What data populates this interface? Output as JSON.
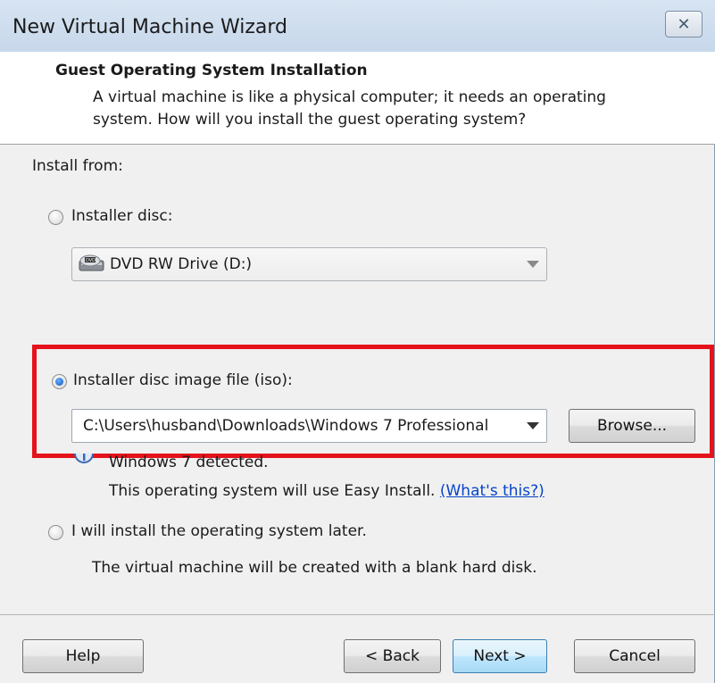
{
  "window": {
    "title": "New Virtual Machine Wizard",
    "close_glyph": "✕"
  },
  "header": {
    "title": "Guest Operating System Installation",
    "description": "A virtual machine is like a physical computer; it needs an operating system. How will you install the guest operating system?"
  },
  "install": {
    "label": "Install from:",
    "disc_option": {
      "label": "Installer disc:",
      "selected": false,
      "drive_value": "DVD RW Drive (D:)",
      "drive_icon": "dvd-drive-icon"
    },
    "iso_option": {
      "label": "Installer disc image file (iso):",
      "selected": true,
      "path_value": "C:\\Users\\husband\\Downloads\\Windows 7 Professional",
      "browse_label": "Browse..."
    },
    "detection": {
      "icon": "info-icon",
      "line1": "Windows 7 detected.",
      "line2": "This operating system will use Easy Install.",
      "link": "(What's this?)"
    },
    "later_option": {
      "label": "I will install the operating system later.",
      "selected": false,
      "note": "The virtual machine will be created with a blank hard disk."
    }
  },
  "footer": {
    "help": "Help",
    "back": "< Back",
    "next": "Next >",
    "cancel": "Cancel"
  },
  "colors": {
    "highlight": "#e4131b",
    "link": "#0645c8",
    "header_bg": "#ffffff",
    "body_bg": "#f0f0f0"
  }
}
